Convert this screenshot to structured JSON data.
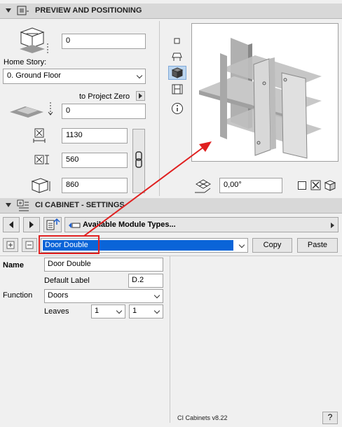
{
  "preview": {
    "title": "PREVIEW AND POSITIONING",
    "elevation_value": "0",
    "home_story_label": "Home Story:",
    "home_story_value": "0. Ground Floor",
    "to_project_zero_label": "to Project Zero",
    "project_zero_value": "0",
    "width_value": "1130",
    "depth_value": "560",
    "height_value": "860",
    "angle_value": "0,00°"
  },
  "settings": {
    "title": "CI CABINET - SETTINGS",
    "module_types_label": "Available Module Types...",
    "module_value": "Door Double",
    "copy_label": "Copy",
    "paste_label": "Paste",
    "name_label": "Name",
    "name_value": "Door Double",
    "default_label_label": "Default Label",
    "default_label_value": "D.2",
    "function_label": "Function",
    "function_value": "Doors",
    "leaves_label": "Leaves",
    "leaves_value_1": "1",
    "leaves_value_2": "1",
    "version": "CI Cabinets v8.22",
    "help_label": "?"
  },
  "colors": {
    "highlight": "#0a64d8",
    "annotation": "#e02020"
  }
}
